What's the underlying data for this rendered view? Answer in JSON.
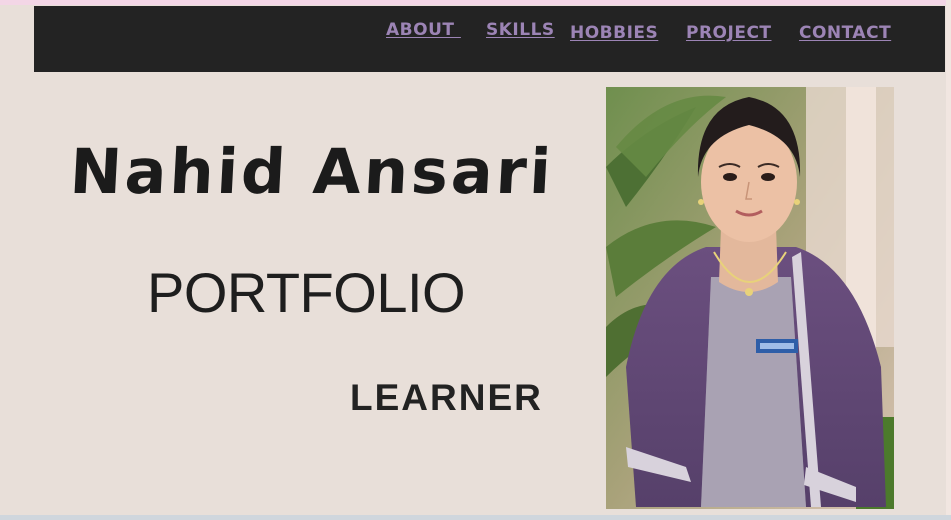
{
  "nav": {
    "links": [
      "ABOUT ",
      "SKILLS",
      "HOBBIES",
      "PROJECT",
      "CONTACT"
    ]
  },
  "hero": {
    "name": "Nahid Ansari",
    "subtitle": "PORTFOLIO",
    "role": "LEARNER"
  },
  "colors": {
    "background": "#e8dfd9",
    "navbar": "#232323",
    "nav_link": "#9c84b5",
    "text": "#1e1e1e"
  }
}
